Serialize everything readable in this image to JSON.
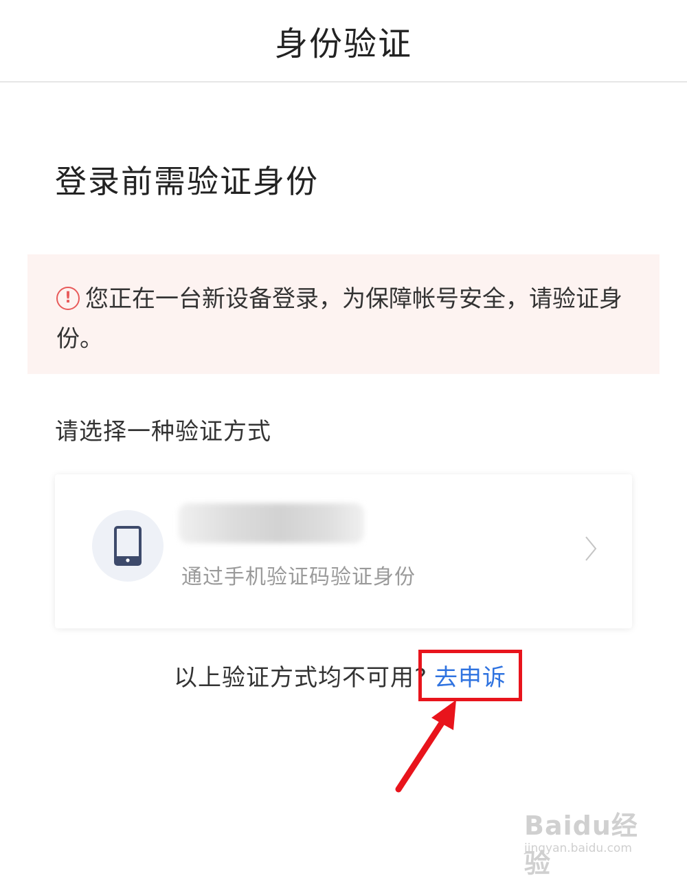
{
  "header": {
    "title": "身份验证"
  },
  "page": {
    "title": "登录前需验证身份"
  },
  "notice": {
    "text": "您正在一台新设备登录，为保障帐号安全，请验证身份。",
    "icon": "warning-circle-icon",
    "background": "#fdf3f1",
    "icon_color": "#e85a5a"
  },
  "methods": {
    "label": "请选择一种验证方式",
    "items": [
      {
        "icon": "mobile-phone-icon",
        "description": "通过手机验证码验证身份"
      }
    ]
  },
  "footer": {
    "question": "以上验证方式均不可用?",
    "appeal_link": "去申诉",
    "link_color": "#2f73e0",
    "highlight_color": "#e8141c"
  },
  "watermark": {
    "brand": "Baidu经验",
    "url": "jingyan.baidu.com"
  }
}
